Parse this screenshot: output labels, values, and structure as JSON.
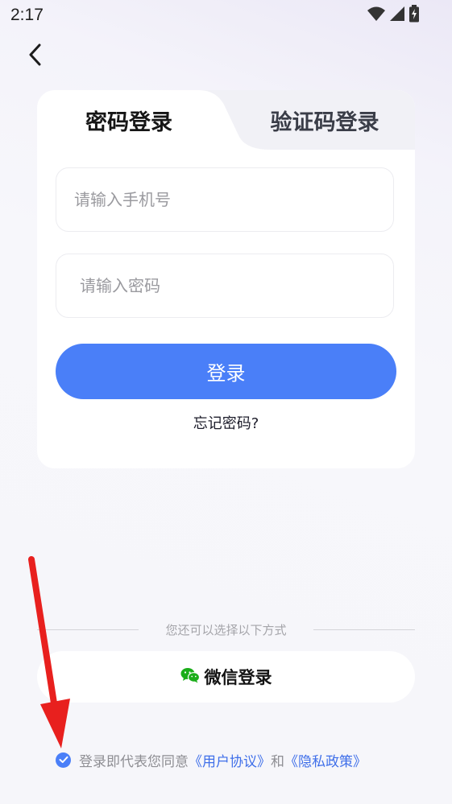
{
  "status_bar": {
    "time": "2:17",
    "icons": [
      "wifi-icon",
      "cellular-signal-icon",
      "battery-charging-icon"
    ]
  },
  "nav": {
    "back_icon": "chevron-left-icon"
  },
  "login_card": {
    "tabs": [
      {
        "label": "密码登录",
        "active": true
      },
      {
        "label": "验证码登录",
        "active": false
      }
    ],
    "phone_input": {
      "placeholder": "请输入手机号",
      "value": ""
    },
    "password_input": {
      "placeholder": "请输入密码",
      "value": ""
    },
    "login_button": "登录",
    "forgot_password": "忘记密码?"
  },
  "alternatives": {
    "divider_text": "您还可以选择以下方式",
    "wechat_button": "微信登录",
    "wechat_icon": "wechat-icon"
  },
  "agreement": {
    "checked": true,
    "prefix": "登录即代表您同意",
    "user_agreement": "《用户协议》",
    "conjunction": "和",
    "privacy_policy": "《隐私政策》"
  },
  "colors": {
    "accent": "#4a7ff8",
    "link": "#3f6fe9",
    "background": "#f6f6fa",
    "annotation_arrow": "#e8201e"
  }
}
